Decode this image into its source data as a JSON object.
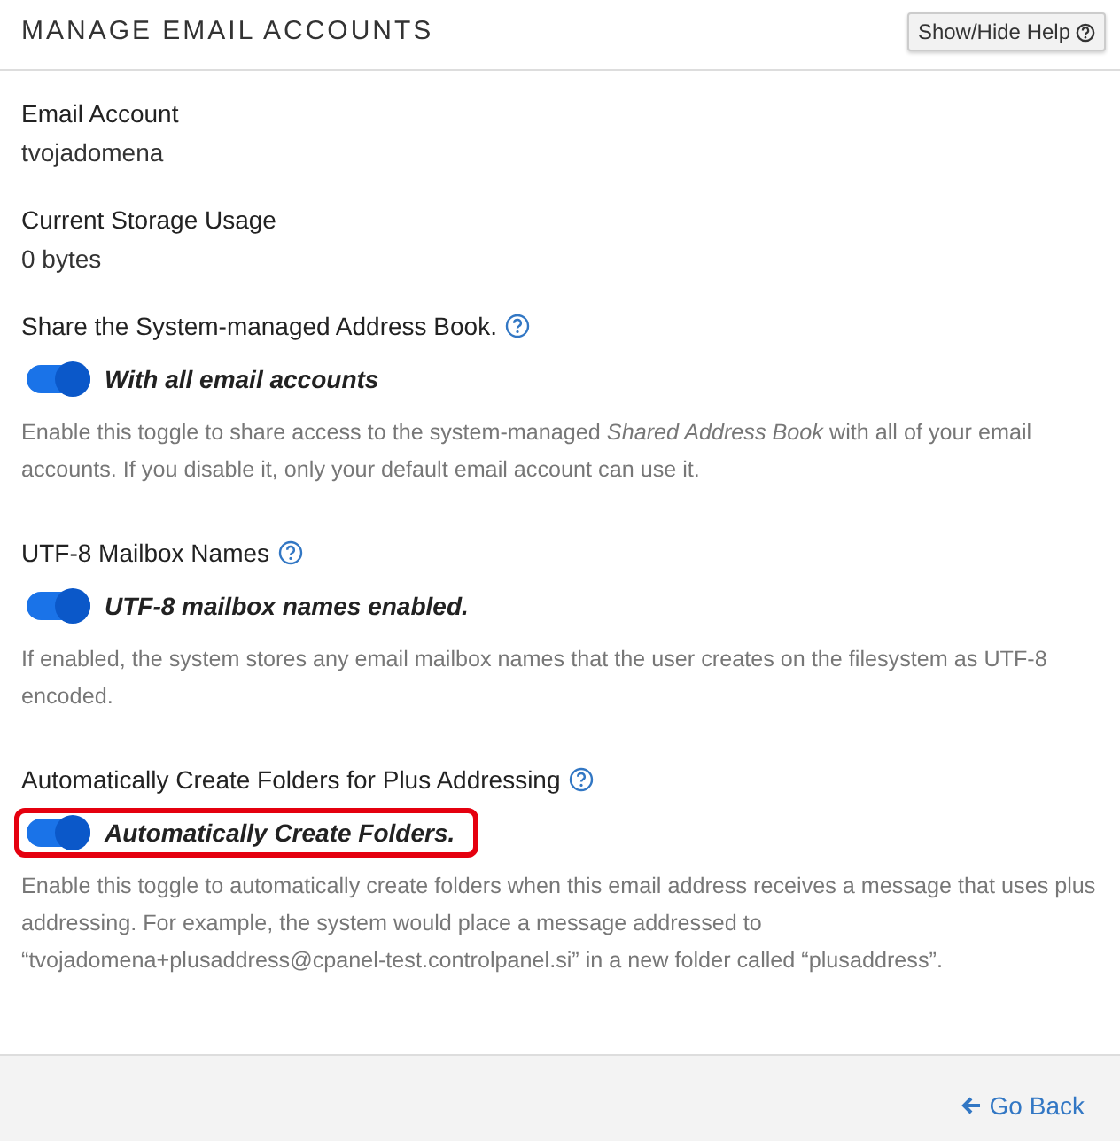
{
  "header": {
    "title": "MANAGE EMAIL ACCOUNTS",
    "help_button": "Show/Hide Help"
  },
  "info": [
    {
      "label": "Email Account",
      "value": "tvojadomena"
    },
    {
      "label": "Current Storage Usage",
      "value": "0 bytes"
    }
  ],
  "settings": [
    {
      "label": "Share the System-managed Address Book.",
      "on": true,
      "toggle_label": "With all email accounts",
      "highlighted": false,
      "description": "Enable this toggle to share access to the system-managed *Shared Address Book* with all of your email accounts. If you disable it, only your default email account can use it."
    },
    {
      "label": "UTF-8 Mailbox Names",
      "on": true,
      "toggle_label": "UTF-8 mailbox names enabled.",
      "highlighted": false,
      "description": "If enabled, the system stores any email mailbox names that the user creates on the filesystem as UTF-8 encoded."
    },
    {
      "label": "Automatically Create Folders for Plus Addressing",
      "on": true,
      "toggle_label": "Automatically Create Folders.",
      "highlighted": true,
      "description": "Enable this toggle to automatically create folders when this email address receives a message that uses plus addressing. For example, the system would place a message addressed to “tvojadomena+plusaddress@cpanel-test.controlpanel.si” in a new folder called “plusaddress”."
    }
  ],
  "footer": {
    "back_link": "Go Back"
  }
}
